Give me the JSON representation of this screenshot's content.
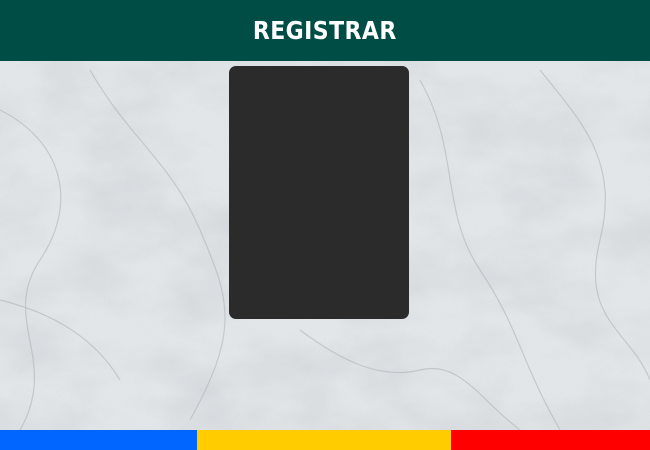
{
  "header": {
    "title": "REGISTRAR"
  },
  "colors": {
    "header_bg": "#004d46",
    "card_bg": "#2b2b2b",
    "stripe_blue": "#0066ff",
    "stripe_yellow": "#ffcc00",
    "stripe_red": "#ff0000"
  },
  "background": {
    "texture": "marble"
  },
  "stripes": [
    "blue",
    "yellow",
    "red"
  ]
}
